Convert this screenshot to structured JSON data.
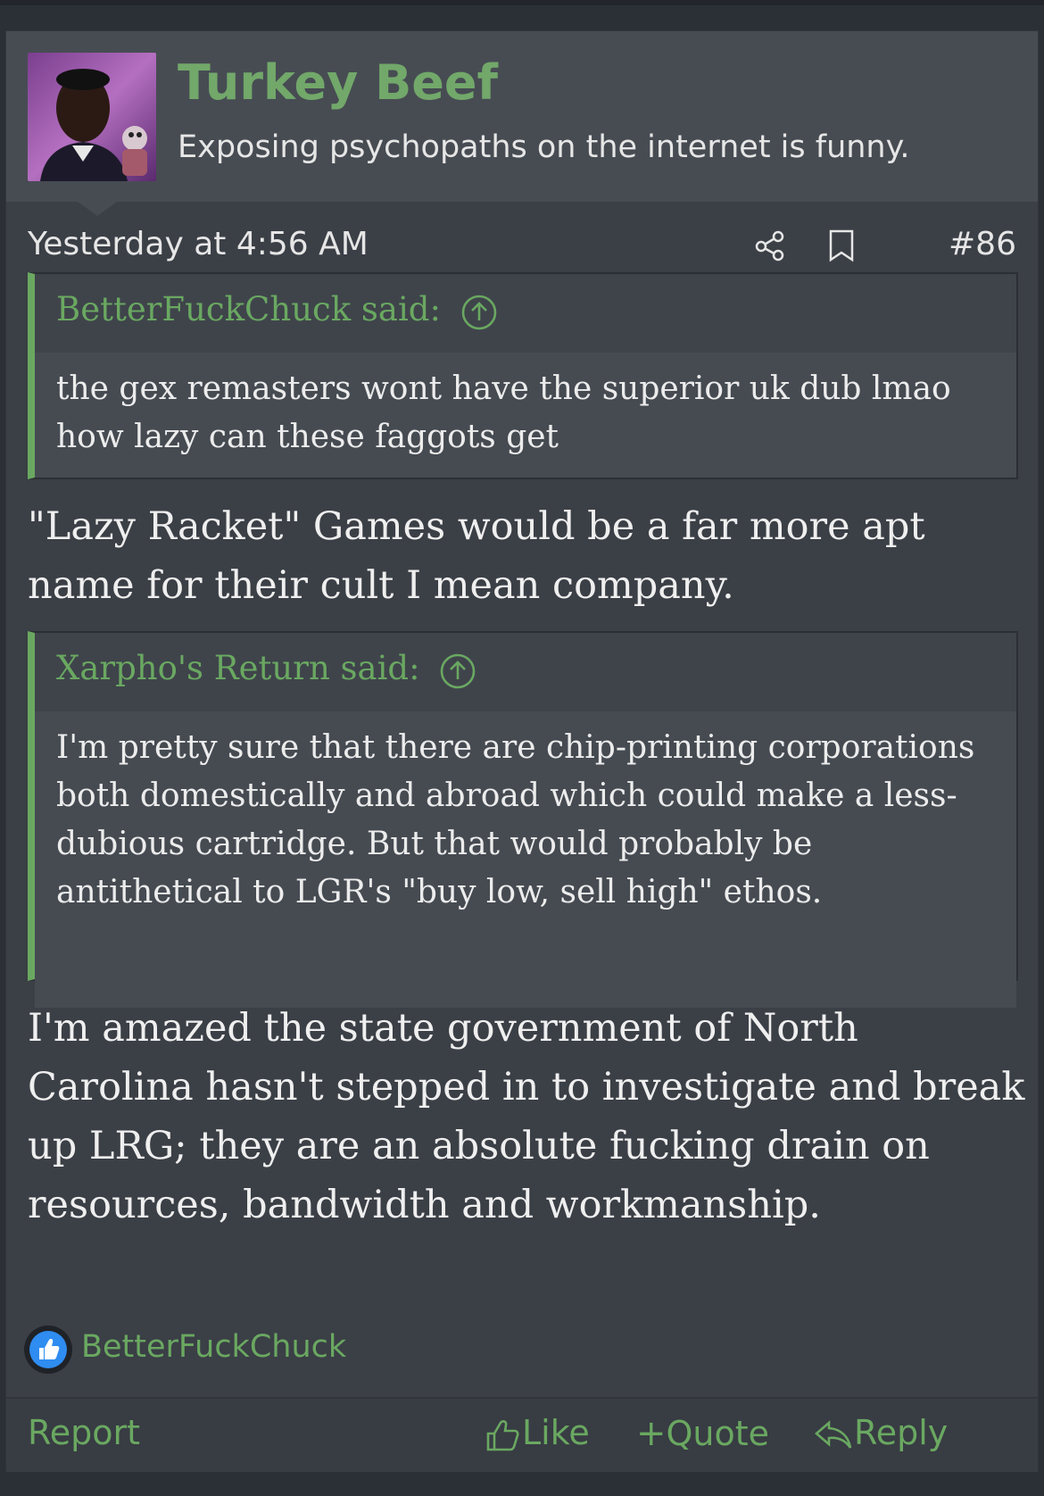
{
  "post": {
    "author": "Turkey Beef",
    "user_title": "Exposing psychopaths on the internet is funny.",
    "timestamp": "Yesterday at 4:56 AM",
    "post_number": "#86",
    "quotes": [
      {
        "attribution": "BetterFuckChuck said:",
        "text": "the gex remasters wont have the superior uk dub lmao how lazy can these faggots get"
      },
      {
        "attribution": "Xarpho's Return said:",
        "text": "I'm pretty sure that there are chip-printing corporations both domestically and abroad which could make a less-dubious cartridge. But that would probably be antithetical to LGR's \"buy low, sell high\" ethos."
      }
    ],
    "replies": [
      "\"Lazy Racket\" Games would be a far more apt name for their cult I mean company.",
      "I'm amazed the state government of North Carolina hasn't stepped in to investigate and break up LRG; they are an absolute fucking drain on resources, bandwidth and workmanship."
    ],
    "reaction_users": "BetterFuckChuck"
  },
  "actions": {
    "report": "Report",
    "like": "Like",
    "quote": "Quote",
    "reply": "Reply"
  },
  "icons": {
    "share": "share-icon",
    "bookmark": "bookmark-icon",
    "quote_jump": "arrow-up-circle-icon",
    "like_reaction": "thumbs-up-icon",
    "reply": "reply-arrow-icon"
  },
  "colors": {
    "accent_green": "#6aa861",
    "background": "#2b2f36",
    "post_background": "#3b3f46",
    "reaction_blue": "#2f8cf0"
  }
}
